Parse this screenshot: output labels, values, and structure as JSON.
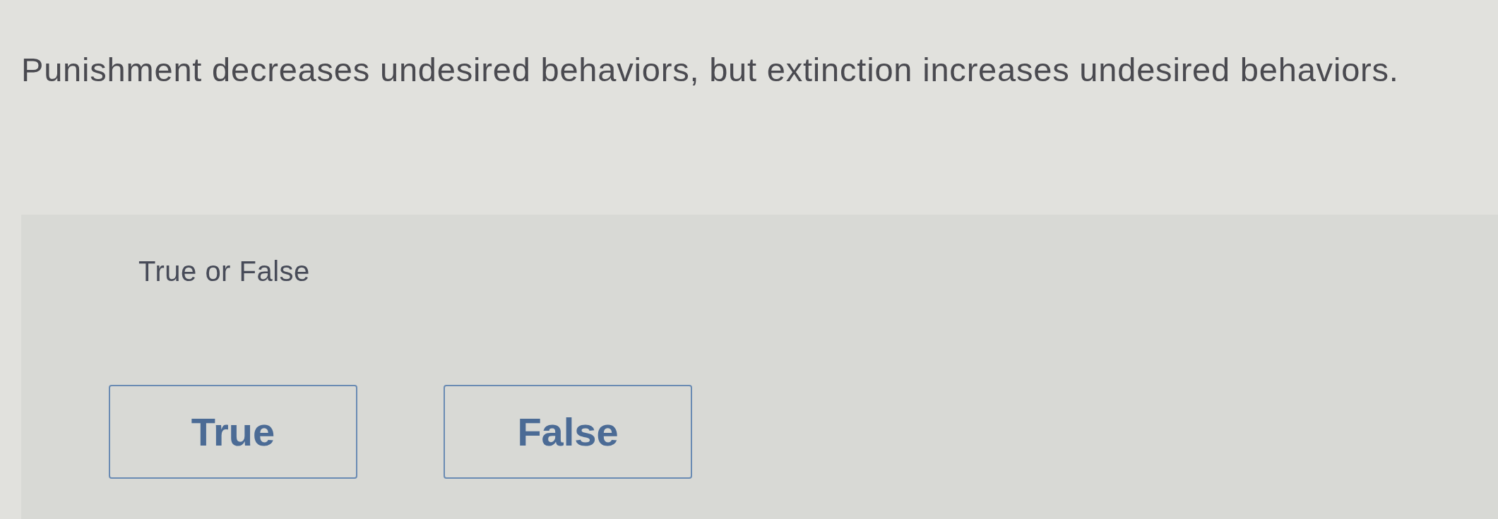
{
  "question": {
    "text": "Punishment decreases undesired behaviors, but extinction increases undesired behaviors."
  },
  "answer_panel": {
    "prompt": "True or False",
    "options": [
      {
        "label": "True",
        "selected": false
      },
      {
        "label": "False",
        "selected": false
      }
    ]
  }
}
